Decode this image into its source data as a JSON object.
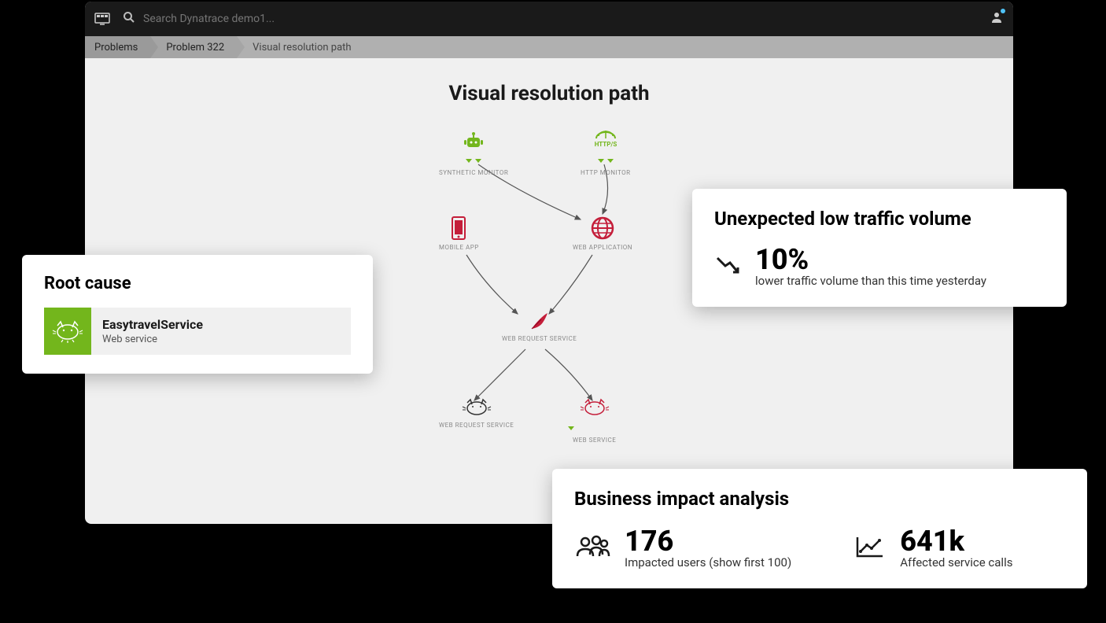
{
  "topbar": {
    "search_placeholder": "Search Dynatrace demo1..."
  },
  "breadcrumbs": {
    "items": [
      "Problems",
      "Problem 322",
      "Visual resolution path"
    ]
  },
  "page": {
    "title": "Visual resolution path"
  },
  "diagram": {
    "nodes": {
      "synthetic_monitor": "SYNTHETIC MONITOR",
      "http_monitor": "HTTP MONITOR",
      "mobile_app": "MOBILE APP",
      "web_application": "WEB APPLICATION",
      "web_request_service": "WEB REQUEST SERVICE",
      "web_request_service_2": "WEB REQUEST SERVICE",
      "web_service": "WEB SERVICE"
    }
  },
  "root_cause": {
    "title": "Root cause",
    "item": {
      "name": "EasytravelService",
      "type": "Web service"
    }
  },
  "traffic": {
    "title": "Unexpected low traffic volume",
    "value": "10%",
    "description": "lower traffic volume than this time yesterday"
  },
  "impact": {
    "title": "Business impact analysis",
    "users": {
      "value": "176",
      "label": "Impacted users (show first 100)"
    },
    "calls": {
      "value": "641k",
      "label": "Affected service calls"
    }
  },
  "colors": {
    "green": "#73b61c",
    "red": "#c41e3a"
  }
}
